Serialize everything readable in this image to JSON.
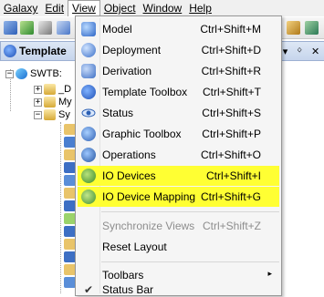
{
  "menubar": {
    "items": [
      {
        "label": "Galaxy"
      },
      {
        "label": "Edit"
      },
      {
        "label": "View"
      },
      {
        "label": "Object"
      },
      {
        "label": "Window"
      },
      {
        "label": "Help"
      }
    ]
  },
  "pane": {
    "title": "Template",
    "pin_glyph": "▾",
    "close_glyph": "✕"
  },
  "tree": {
    "root_label": "SWTB:",
    "children": [
      {
        "label": "_D",
        "expander": "⊞"
      },
      {
        "label": "My",
        "expander": "⊞"
      },
      {
        "label": "Sy",
        "expander": "⊟"
      }
    ],
    "root_expander": "⊟"
  },
  "view_menu": {
    "items": [
      {
        "label": "Model",
        "shortcut": "Ctrl+Shift+M",
        "icon": "model-icon",
        "highlighted": false,
        "enabled": true
      },
      {
        "label": "Deployment",
        "shortcut": "Ctrl+Shift+D",
        "icon": "deployment-icon",
        "highlighted": false,
        "enabled": true
      },
      {
        "label": "Derivation",
        "shortcut": "Ctrl+Shift+R",
        "icon": "derivation-icon",
        "highlighted": false,
        "enabled": true
      },
      {
        "label": "Template Toolbox",
        "shortcut": "Ctrl+Shift+T",
        "icon": "template-toolbox-icon",
        "highlighted": false,
        "enabled": true
      },
      {
        "label": "Status",
        "shortcut": "Ctrl+Shift+S",
        "icon": "status-eye-icon",
        "highlighted": false,
        "enabled": true
      },
      {
        "label": "Graphic Toolbox",
        "shortcut": "Ctrl+Shift+P",
        "icon": "graphic-toolbox-icon",
        "highlighted": false,
        "enabled": true
      },
      {
        "label": "Operations",
        "shortcut": "Ctrl+Shift+O",
        "icon": "operations-icon",
        "highlighted": false,
        "enabled": true
      },
      {
        "label": "IO Devices",
        "shortcut": "Ctrl+Shift+I",
        "icon": "io-devices-icon",
        "highlighted": true,
        "enabled": true
      },
      {
        "label": "IO Device Mapping",
        "shortcut": "Ctrl+Shift+G",
        "icon": "io-device-mapping-icon",
        "highlighted": true,
        "enabled": true
      },
      {
        "label": "Synchronize Views",
        "shortcut": "Ctrl+Shift+Z",
        "icon": "",
        "highlighted": false,
        "enabled": false
      },
      {
        "label": "Reset Layout",
        "shortcut": "",
        "icon": "",
        "highlighted": false,
        "enabled": true
      },
      {
        "label": "Toolbars",
        "shortcut": "",
        "icon": "",
        "highlighted": false,
        "enabled": true,
        "submenu_glyph": "▸"
      },
      {
        "label": "Status Bar",
        "shortcut": "",
        "icon": "checkmark-icon",
        "highlighted": false,
        "enabled": true,
        "checked": true,
        "check_glyph": "✔"
      }
    ]
  },
  "colors": {
    "highlight": "#ffff33",
    "menu_bg": "#f5f5f5",
    "disabled_text": "#8d8d8d"
  }
}
